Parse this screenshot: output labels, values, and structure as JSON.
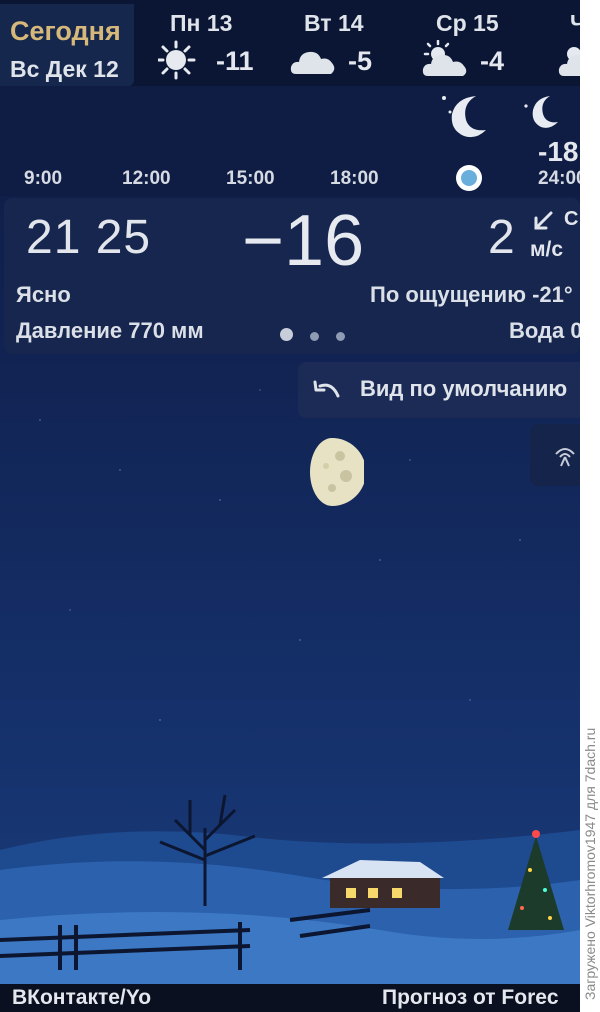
{
  "today": {
    "title": "Сегодня",
    "date": "Вс Дек 12"
  },
  "days": [
    {
      "label": "Пн 13",
      "temp": "-11",
      "icon": "sun-icon"
    },
    {
      "label": "Вт 14",
      "temp": "-5",
      "icon": "cloud-icon"
    },
    {
      "label": "Ср 15",
      "temp": "-4",
      "icon": "partly-cloudy-icon"
    },
    {
      "label": "Ч",
      "temp": "",
      "icon": "partly-cloudy-icon"
    }
  ],
  "hourly": {
    "labels": [
      "9:00",
      "12:00",
      "15:00",
      "18:00",
      "24:00"
    ],
    "temp": "-18"
  },
  "current": {
    "time": "21 25",
    "temperature": "−16",
    "wind_speed": "2",
    "wind_dir": "С",
    "wind_unit": "м/с",
    "condition": "Ясно",
    "feels_like": "По ощущению -21°",
    "pressure": "Давление 770 мм",
    "water": "Вода 0"
  },
  "buttons": {
    "default_view": "Вид по умолчанию"
  },
  "footer": {
    "left": "ВКонтакте/Yo",
    "right": "Прогноз от Forec"
  },
  "watermark": "Загружено Viktorhromov1947 для 7dach.ru",
  "colors": {
    "accent": "#d6b97a",
    "panel": "#16264e",
    "sky_top": "#0d1a3f"
  }
}
